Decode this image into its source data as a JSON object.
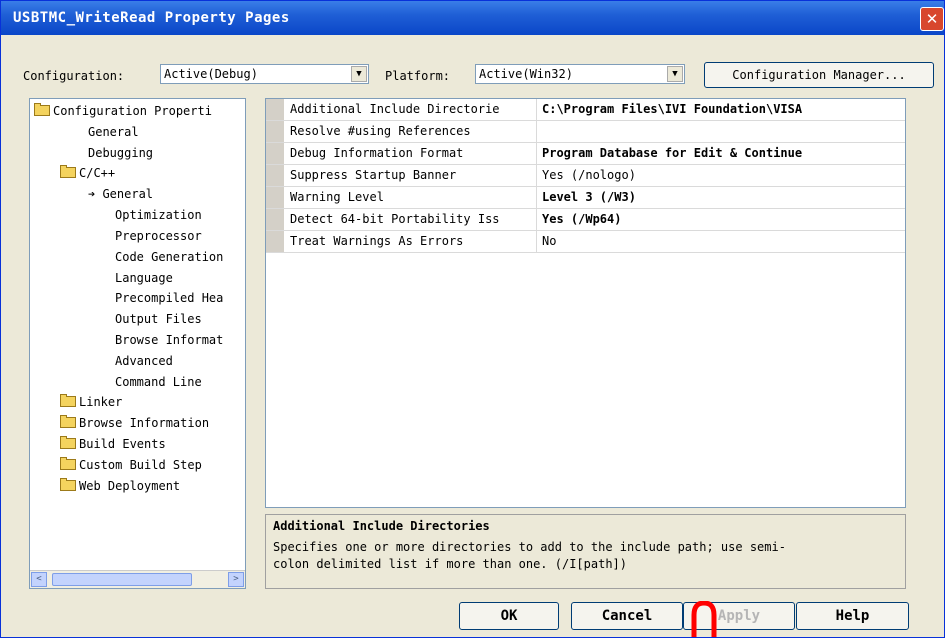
{
  "window": {
    "title": "USBTMC_WriteRead Property Pages",
    "close_glyph": "✕"
  },
  "toolbar": {
    "configuration_label": "Configuration:",
    "configuration_value": "Active(Debug)",
    "platform_label": "Platform:",
    "platform_value": "Active(Win32)",
    "configuration_manager_label": "Configuration Manager..."
  },
  "tree": {
    "items": [
      {
        "label": "Configuration Properti",
        "icon": "folder-open-icon"
      },
      {
        "label": "General"
      },
      {
        "label": "Debugging"
      },
      {
        "label": "C/C++",
        "icon": "folder-open-icon"
      },
      {
        "label": "General",
        "icon": "arrow-right-icon",
        "selected": true
      },
      {
        "label": "Optimization"
      },
      {
        "label": "Preprocessor"
      },
      {
        "label": "Code Generation"
      },
      {
        "label": "Language"
      },
      {
        "label": "Precompiled Hea"
      },
      {
        "label": "Output Files"
      },
      {
        "label": "Browse Informat"
      },
      {
        "label": "Advanced"
      },
      {
        "label": "Command Line"
      },
      {
        "label": "Linker",
        "icon": "folder-icon"
      },
      {
        "label": "Browse Information",
        "icon": "folder-icon"
      },
      {
        "label": "Build Events",
        "icon": "folder-icon"
      },
      {
        "label": "Custom Build Step",
        "icon": "folder-icon"
      },
      {
        "label": "Web Deployment",
        "icon": "folder-icon"
      }
    ],
    "scroll_left_glyph": "<",
    "scroll_right_glyph": ">"
  },
  "properties": {
    "rows": [
      {
        "name": "Additional Include Directorie",
        "value": "C:\\Program Files\\IVI Foundation\\VISA",
        "bold": true
      },
      {
        "name": "Resolve #using References",
        "value": "",
        "bold": false
      },
      {
        "name": "Debug Information Format",
        "value": "Program Database for Edit & Continue",
        "bold": true
      },
      {
        "name": "Suppress Startup Banner",
        "value": "Yes (/nologo)",
        "bold": false
      },
      {
        "name": "Warning Level",
        "value": "Level 3 (/W3)",
        "bold": true
      },
      {
        "name": "Detect 64-bit Portability Iss",
        "value": "Yes (/Wp64)",
        "bold": true
      },
      {
        "name": "Treat Warnings As Errors",
        "value": "No",
        "bold": false
      }
    ]
  },
  "description": {
    "title": "Additional Include Directories",
    "text": "Specifies one or more directories to add to the include path; use semi-\ncolon delimited list if more than one.     (/I[path])"
  },
  "buttons": {
    "ok": "OK",
    "cancel": "Cancel",
    "apply": "Apply",
    "help": "Help"
  },
  "colors": {
    "titlebar": "#0a46c8",
    "close": "#d8472d",
    "watermark": "#ff0000"
  }
}
